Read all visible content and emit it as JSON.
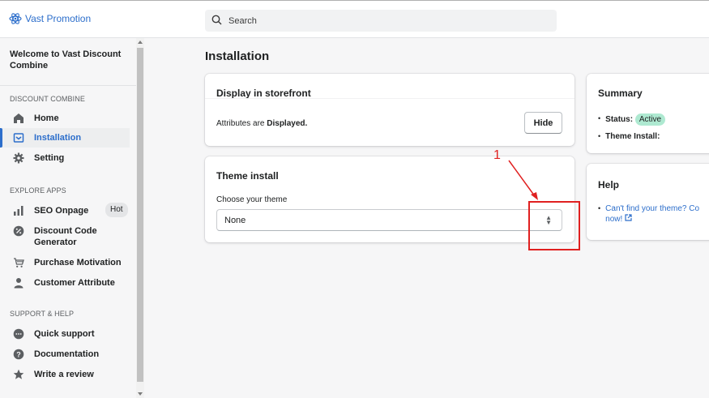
{
  "brand": {
    "name": "Vast Promotion"
  },
  "search": {
    "placeholder": "Search"
  },
  "sidebar": {
    "welcome": "Welcome to Vast Discount Combine",
    "section_discount": "DISCOUNT COMBINE",
    "section_explore": "EXPLORE APPS",
    "section_support": "SUPPORT & HELP",
    "items": {
      "home": "Home",
      "installation": "Installation",
      "setting": "Setting",
      "seo_onpage": "SEO Onpage",
      "hot_badge": "Hot",
      "discount_code_generator": "Discount Code Generator",
      "purchase_motivation": "Purchase Motivation",
      "customer_attribute": "Customer Attribute",
      "quick_support": "Quick support",
      "documentation": "Documentation",
      "write_review": "Write a review"
    }
  },
  "main": {
    "title": "Installation",
    "display_card": {
      "title": "Display in storefront",
      "text_prefix": "Attributes are ",
      "text_bold": "Displayed.",
      "hide_button": "Hide"
    },
    "theme_card": {
      "title": "Theme install",
      "label": "Choose your theme",
      "selected": "None"
    },
    "summary_card": {
      "title": "Summary",
      "status_label": "Status:",
      "status_value": "Active",
      "theme_install_label": "Theme Install:"
    },
    "help_card": {
      "title": "Help",
      "link_line1": "Can't find your theme? Co",
      "link_line2": "now!"
    }
  },
  "annotation": {
    "number": "1",
    "color": "#e02020"
  },
  "colors": {
    "accent": "#2c6ecb",
    "active_badge": "#aee9d1"
  }
}
